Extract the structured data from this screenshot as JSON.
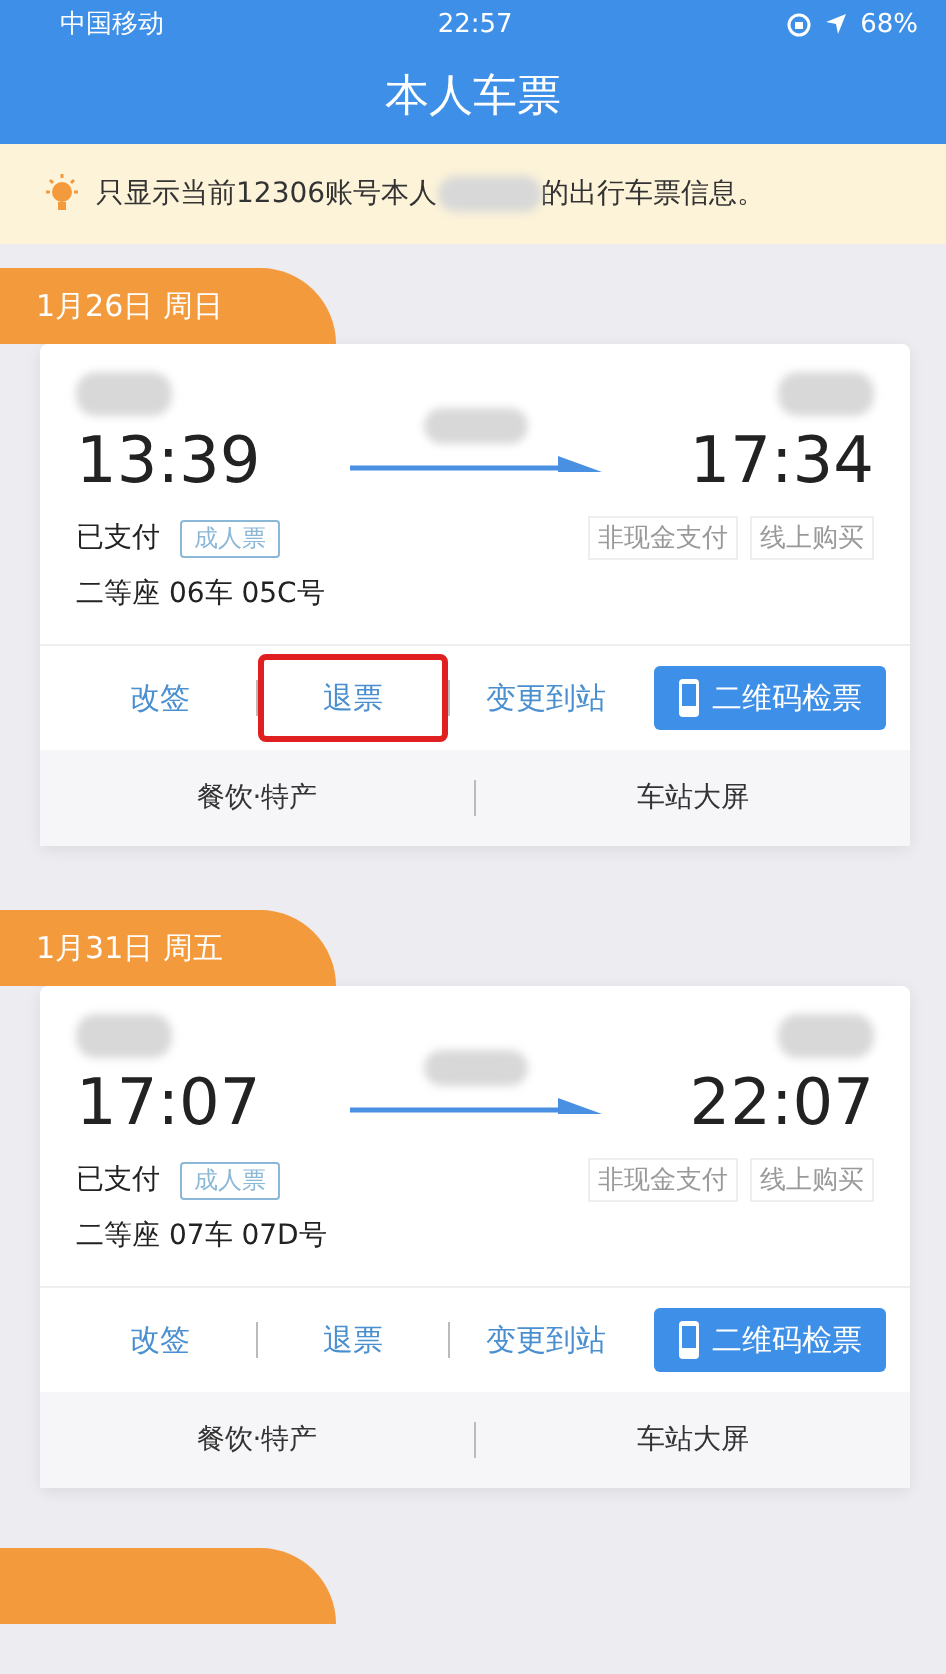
{
  "status_bar": {
    "carrier": "中国移动",
    "time": "22:57",
    "battery": "68%"
  },
  "title": "本人车票",
  "notice": {
    "before": "只显示当前12306账号本人",
    "after": "的出行车票信息。"
  },
  "trips": [
    {
      "date": "1月26日 周日",
      "depart_time": "13:39",
      "arrive_time": "17:34",
      "payment": "已支付",
      "ticket_type": "成人票",
      "tags": [
        "非现金支付",
        "线上购买"
      ],
      "seat": "二等座 06车 05C号",
      "actions": [
        {
          "label": "改签",
          "kind": "link",
          "highlighted": false
        },
        {
          "label": "退票",
          "kind": "link",
          "highlighted": true
        },
        {
          "label": "变更到站",
          "kind": "link",
          "highlighted": false
        },
        {
          "label": "二维码检票",
          "kind": "primary",
          "highlighted": false
        }
      ],
      "services": [
        "餐饮·特产",
        "车站大屏"
      ]
    },
    {
      "date": "1月31日 周五",
      "depart_time": "17:07",
      "arrive_time": "22:07",
      "payment": "已支付",
      "ticket_type": "成人票",
      "tags": [
        "非现金支付",
        "线上购买"
      ],
      "seat": "二等座 07车 07D号",
      "actions": [
        {
          "label": "改签",
          "kind": "link",
          "highlighted": false
        },
        {
          "label": "退票",
          "kind": "link",
          "highlighted": false
        },
        {
          "label": "变更到站",
          "kind": "link",
          "highlighted": false
        },
        {
          "label": "二维码检票",
          "kind": "primary",
          "highlighted": false
        }
      ],
      "services": [
        "餐饮·特产",
        "车站大屏"
      ]
    }
  ]
}
